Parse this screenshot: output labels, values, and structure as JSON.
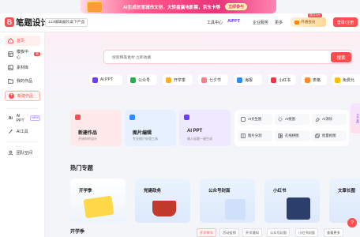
{
  "promo": {
    "text": "AI生成创意城市文创，大转盘赢电影票，京东卡等",
    "button": "立即参与"
  },
  "header": {
    "logo_text": "笔题设计",
    "install_label": "123编辑器装桌下产品",
    "nav": [
      "工具中心",
      "AIPPT",
      "企业服务",
      "更多"
    ],
    "vip_label": "开通会员",
    "vip_tag": "首月1元",
    "login_label": "登录/注册"
  },
  "sidebar": {
    "items": [
      {
        "label": "首页",
        "icon": "home-icon"
      },
      {
        "label": "模板中心",
        "icon": "template-icon",
        "badge": "新"
      },
      {
        "label": "素材库",
        "icon": "material-icon"
      },
      {
        "label": "我的作品",
        "icon": "folder-icon"
      }
    ],
    "new_work_label": "新建作品",
    "ai_items": [
      {
        "label": "AI PPT",
        "badge": "NEW"
      },
      {
        "label": "AI工具"
      }
    ],
    "team_label": "团队空间"
  },
  "search": {
    "placeholder": "搜索精美素材 立即收藏",
    "button": "搜索"
  },
  "quick_links": [
    "AI PPT",
    "公众号",
    "开学季",
    "七夕节",
    "海报",
    "小红书",
    "表格",
    "免费允"
  ],
  "feature_cards": [
    {
      "title": "新建作品",
      "subtitle": "开始你的设计",
      "color": "#ffe9ea"
    },
    {
      "title": "图片编辑",
      "subtitle": "专业图片处理工具",
      "color": "#e7f0ff"
    },
    {
      "title": "AI PPT",
      "subtitle": "输入标题一键生成",
      "color": "#efe9ff"
    }
  ],
  "tools": [
    "AI文生图",
    "AI抠图",
    "AI消除",
    "图片分割",
    "在线拼图",
    "批量抠图"
  ],
  "hot_section_title": "热门专题",
  "hot_topics": [
    "开学季",
    "党建政务",
    "公众号封面",
    "小红书",
    "文章长图"
  ],
  "category_row": {
    "title": "开学季",
    "chips": [
      "开学季节",
      "活动促销",
      "开学通知",
      "公众号封面",
      "小红书封面",
      "查看更多"
    ]
  },
  "floating_panel": "AI工具"
}
